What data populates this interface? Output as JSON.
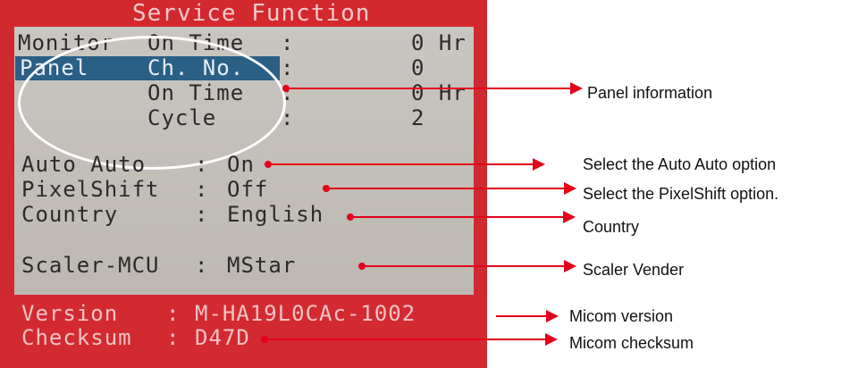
{
  "osd": {
    "title": "Service Function",
    "rows": {
      "monitor": {
        "label": "Monitor",
        "sub": "On Time",
        "sep": ":",
        "value": "0 Hr"
      },
      "panel_ch": {
        "label": "Panel",
        "sub": "Ch. No.",
        "sep": ":",
        "value": "0"
      },
      "panel_on": {
        "sub": "On Time",
        "sep": ":",
        "value": "0 Hr"
      },
      "panel_cycle": {
        "sub": "Cycle",
        "sep": ":",
        "value": "2"
      },
      "auto": {
        "label": "Auto Auto",
        "sep": ":",
        "value": "On"
      },
      "pixel": {
        "label": "PixelShift",
        "sep": ":",
        "value": "Off"
      },
      "country": {
        "label": "Country",
        "sep": ":",
        "value": "English"
      },
      "scaler": {
        "label": "Scaler-MCU",
        "sep": ":",
        "value": "MStar"
      },
      "version": {
        "label": "Version",
        "sep": ":",
        "value": "M-HA19L0CAc-1002"
      },
      "checksum": {
        "label": "Checksum",
        "sep": ":",
        "value": "D47D"
      }
    }
  },
  "annotations": {
    "panel_info": "Panel information",
    "auto_auto": "Select the Auto Auto option",
    "pixelshift": "Select the PixelShift option.",
    "country": "Country",
    "scaler": "Scaler Vender",
    "micom_version": "Micom version",
    "micom_checksum": "Micom checksum"
  },
  "colors": {
    "osd_red": "#d2282e",
    "osd_body": "#c4bfb9",
    "highlight": "#2a5f86",
    "arrow": "#e3001b"
  }
}
